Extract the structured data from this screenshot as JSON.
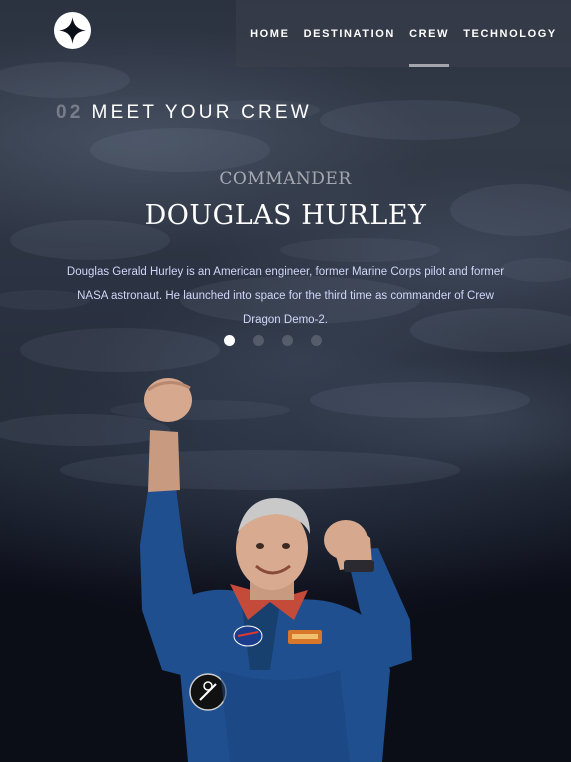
{
  "nav": {
    "items": [
      {
        "label": "HOME",
        "active": false
      },
      {
        "label": "DESTINATION",
        "active": false
      },
      {
        "label": "CREW",
        "active": true
      },
      {
        "label": "TECHNOLOGY",
        "active": false
      }
    ]
  },
  "section": {
    "number": "02",
    "title": "MEET YOUR CREW"
  },
  "crew_member": {
    "role": "COMMANDER",
    "name": "DOUGLAS HURLEY",
    "bio": "Douglas Gerald Hurley is an American engineer, former Marine Corps pilot and former NASA astronaut. He launched into space for the third time as commander of Crew Dragon Demo-2."
  },
  "carousel": {
    "active_index": 0,
    "count": 4
  },
  "icons": {
    "logo": "star-logo-icon"
  },
  "colors": {
    "background": "#0b0d17",
    "accent_text": "#d0d6f9",
    "suit_blue": "#1f4f8f"
  }
}
